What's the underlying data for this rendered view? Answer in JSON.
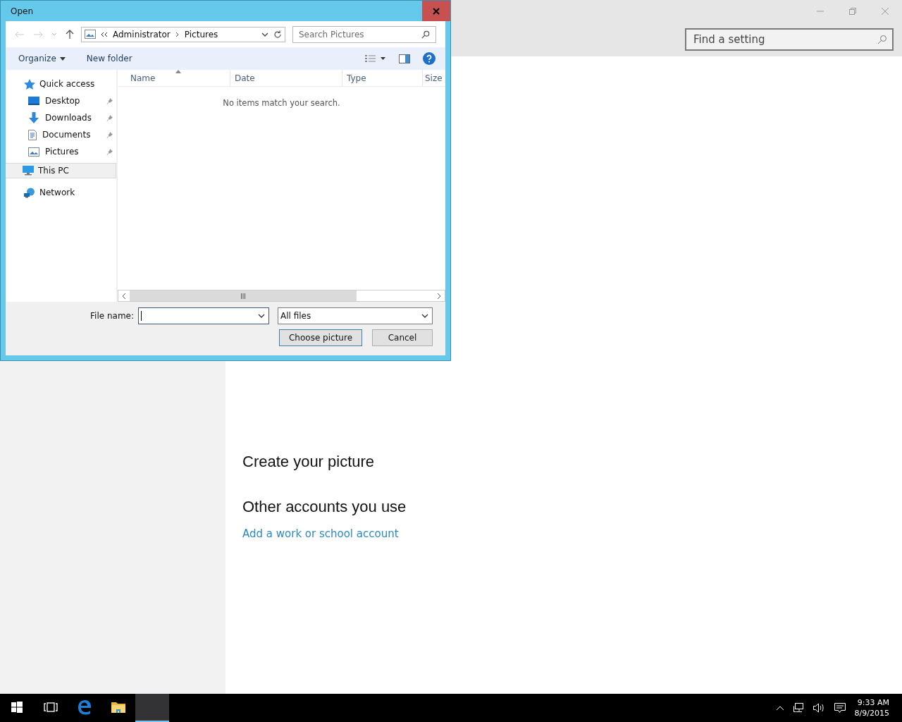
{
  "settings": {
    "search": {
      "placeholder": "Find a setting"
    },
    "headings": [
      "Create your picture",
      "Other accounts you use"
    ],
    "link": "Add a work or school account"
  },
  "dialog": {
    "title": "Open",
    "path": [
      "Administrator",
      "Pictures"
    ],
    "search": {
      "placeholder": "Search Pictures"
    },
    "toolbar": [
      "Organize",
      "New folder"
    ],
    "nav": [
      {
        "label": "Quick access",
        "kind": "star",
        "selected": false,
        "children": [
          {
            "label": "Desktop",
            "kind": "desktop",
            "pinned": true,
            "selected": false
          },
          {
            "label": "Downloads",
            "kind": "download",
            "pinned": true,
            "selected": false
          },
          {
            "label": "Documents",
            "kind": "document",
            "pinned": true,
            "selected": false
          },
          {
            "label": "Pictures",
            "kind": "pictures",
            "pinned": true,
            "selected": false
          }
        ]
      },
      {
        "label": "This PC",
        "kind": "pc",
        "selected": true
      },
      {
        "label": "Network",
        "kind": "network",
        "selected": false
      }
    ],
    "columns": [
      "Name",
      "Date",
      "Type",
      "Size"
    ],
    "empty_message": "No items match your search.",
    "file_name_label": "File name:",
    "file_type": "All files",
    "buttons": [
      {
        "label": "Choose picture",
        "default": true
      },
      {
        "label": "Cancel",
        "default": false
      }
    ]
  },
  "taskbar": {
    "apps": [
      {
        "kind": "start",
        "selected": false
      },
      {
        "kind": "taskview",
        "selected": false
      },
      {
        "kind": "edge",
        "selected": false
      },
      {
        "kind": "explorer",
        "selected": false
      },
      {
        "kind": "blank",
        "selected": true
      }
    ],
    "time": "9:33 AM",
    "date": "8/9/2015"
  }
}
